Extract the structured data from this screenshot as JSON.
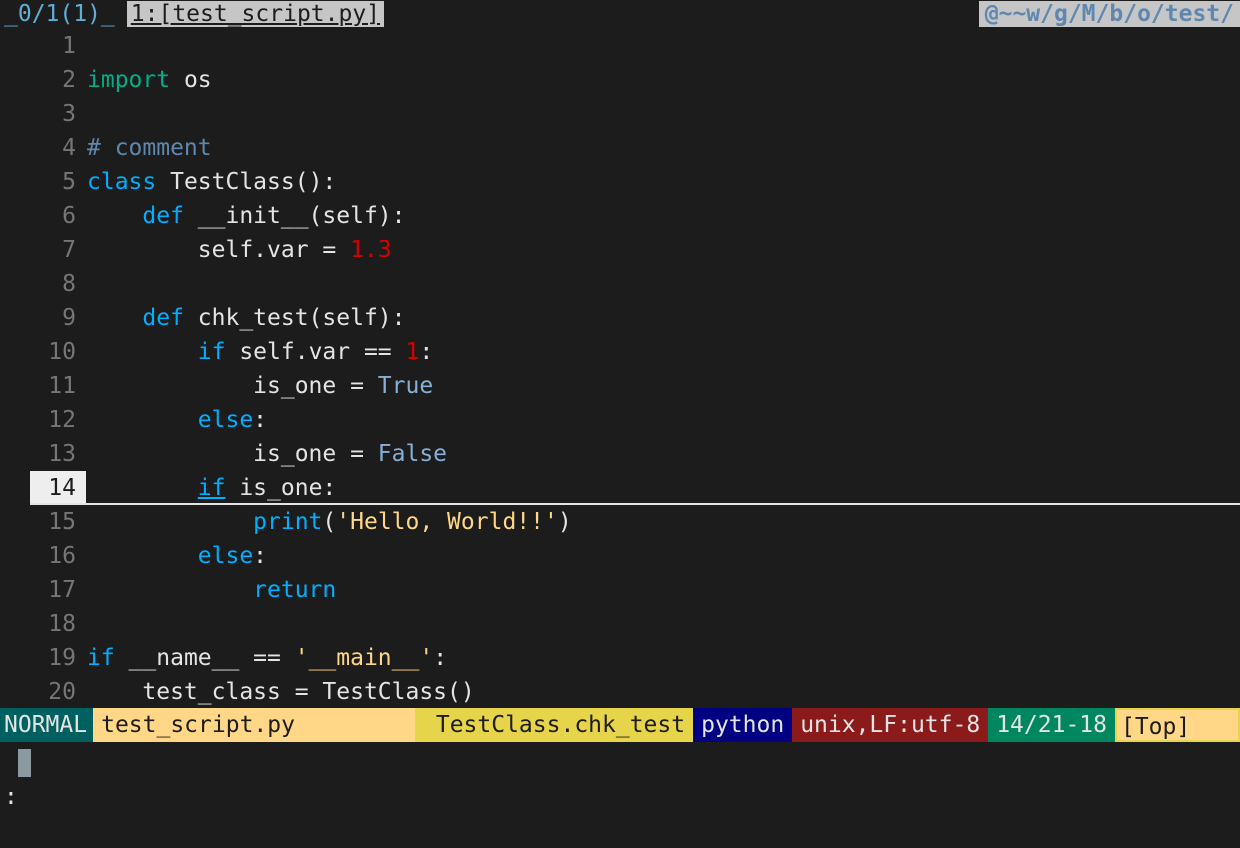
{
  "tabline": {
    "buffer_indicator": "_0/1(1)_",
    "current_tab": "1:[test_script.py]",
    "path": "@~~w/g/M/b/o/test/"
  },
  "editor": {
    "cursor_line": 14,
    "lines": [
      {
        "num": "1",
        "segs": []
      },
      {
        "num": "2",
        "segs": [
          {
            "t": "import",
            "c": "imp"
          },
          {
            "t": " os",
            "c": ""
          }
        ]
      },
      {
        "num": "3",
        "segs": []
      },
      {
        "num": "4",
        "segs": [
          {
            "t": "# comment",
            "c": "cm"
          }
        ]
      },
      {
        "num": "5",
        "segs": [
          {
            "t": "class",
            "c": "kw"
          },
          {
            "t": " TestClass():",
            "c": ""
          }
        ]
      },
      {
        "num": "6",
        "segs": [
          {
            "t": "    ",
            "c": ""
          },
          {
            "t": "def",
            "c": "kw"
          },
          {
            "t": " __init__(self):",
            "c": ""
          }
        ]
      },
      {
        "num": "7",
        "segs": [
          {
            "t": "        self.var = ",
            "c": ""
          },
          {
            "t": "1.3",
            "c": "num"
          }
        ]
      },
      {
        "num": "8",
        "segs": []
      },
      {
        "num": "9",
        "segs": [
          {
            "t": "    ",
            "c": ""
          },
          {
            "t": "def",
            "c": "kw"
          },
          {
            "t": " chk_test(self):",
            "c": ""
          }
        ]
      },
      {
        "num": "10",
        "segs": [
          {
            "t": "        ",
            "c": ""
          },
          {
            "t": "if",
            "c": "kw"
          },
          {
            "t": " self.var == ",
            "c": ""
          },
          {
            "t": "1",
            "c": "num"
          },
          {
            "t": ":",
            "c": ""
          }
        ]
      },
      {
        "num": "11",
        "segs": [
          {
            "t": "            is_one = ",
            "c": ""
          },
          {
            "t": "True",
            "c": "cst"
          }
        ]
      },
      {
        "num": "12",
        "segs": [
          {
            "t": "        ",
            "c": ""
          },
          {
            "t": "else",
            "c": "kw"
          },
          {
            "t": ":",
            "c": ""
          }
        ]
      },
      {
        "num": "13",
        "segs": [
          {
            "t": "            is_one = ",
            "c": ""
          },
          {
            "t": "False",
            "c": "cst"
          }
        ]
      },
      {
        "num": "14",
        "segs": [
          {
            "t": "        ",
            "c": ""
          },
          {
            "t": "if",
            "c": "kw ul"
          },
          {
            "t": " is_one:",
            "c": ""
          }
        ]
      },
      {
        "num": "15",
        "segs": [
          {
            "t": "            ",
            "c": ""
          },
          {
            "t": "print",
            "c": "kw"
          },
          {
            "t": "(",
            "c": ""
          },
          {
            "t": "'Hello, World!!'",
            "c": "str"
          },
          {
            "t": ")",
            "c": ""
          }
        ]
      },
      {
        "num": "16",
        "segs": [
          {
            "t": "        ",
            "c": ""
          },
          {
            "t": "else",
            "c": "kw"
          },
          {
            "t": ":",
            "c": ""
          }
        ]
      },
      {
        "num": "17",
        "segs": [
          {
            "t": "            ",
            "c": ""
          },
          {
            "t": "return",
            "c": "kw"
          }
        ]
      },
      {
        "num": "18",
        "segs": []
      },
      {
        "num": "19",
        "segs": [
          {
            "t": "if",
            "c": "kw"
          },
          {
            "t": " __name__ == ",
            "c": ""
          },
          {
            "t": "'__main__'",
            "c": "str"
          },
          {
            "t": ":",
            "c": ""
          }
        ]
      },
      {
        "num": "20",
        "segs": [
          {
            "t": "    test_class = TestClass()",
            "c": ""
          }
        ]
      }
    ]
  },
  "statusline": {
    "mode": "NORMAL",
    "filename": "test_script.py",
    "function": "TestClass.chk_test",
    "filetype": "python",
    "encoding": "unix,LF:utf-8",
    "position": "14/21-18",
    "scroll": "[Top]"
  },
  "cmdline": {
    "prompt": ":"
  }
}
